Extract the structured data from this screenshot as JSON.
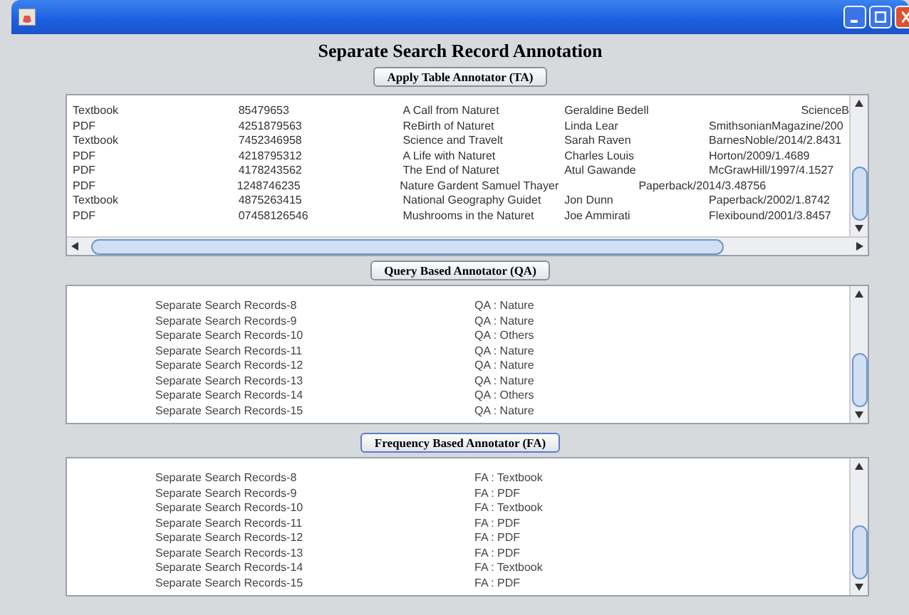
{
  "window": {
    "title": "Separate Search Record Annotation"
  },
  "table_section": {
    "button": "Apply Table Annotator (TA)",
    "rows": [
      {
        "kind": "right",
        "cells": [
          "Textbook",
          "85479653",
          "A Call from Naturet",
          "Geraldine Bedell",
          "ScienceB"
        ]
      },
      {
        "kind": "normal",
        "cells": [
          "PDF",
          "4251879563",
          "ReBirth of Naturet",
          "Linda Lear",
          "SmithsonianMagazine/200"
        ]
      },
      {
        "kind": "normal",
        "cells": [
          "Textbook",
          "7452346958",
          "Science and Travelt",
          "Sarah Raven",
          "BarnesNoble/2014/2.8431"
        ]
      },
      {
        "kind": "normal",
        "cells": [
          "PDF",
          "4218795312",
          "A Life with Naturet",
          "Charles Louis",
          "Horton/2009/1.4689"
        ]
      },
      {
        "kind": "normal",
        "cells": [
          "PDF",
          "4178243562",
          "The End of Naturet",
          "Atul Gawande",
          "McGrawHill/1997/4.1527"
        ]
      },
      {
        "kind": "shifted",
        "cells": [
          "PDF",
          "1248746235",
          "Nature Gardent Samuel Thayer",
          "Paperback/2014/3.48756"
        ]
      },
      {
        "kind": "normal",
        "cells": [
          "Textbook",
          "4875263415",
          "National Geography Guidet",
          "Jon Dunn",
          "Paperback/2002/1.8742"
        ]
      },
      {
        "kind": "normal",
        "cells": [
          "PDF",
          "07458126546",
          "Mushrooms in the Naturet",
          "Joe Ammirati",
          "Flexibound/2001/3.8457"
        ]
      }
    ]
  },
  "qa_section": {
    "button": "Query Based Annotator (QA)",
    "rows": [
      {
        "record": "Separate Search Records-8",
        "label": "QA : Nature"
      },
      {
        "record": "Separate Search Records-9",
        "label": "QA : Nature"
      },
      {
        "record": "Separate Search Records-10",
        "label": "QA : Others"
      },
      {
        "record": "Separate Search Records-11",
        "label": "QA : Nature"
      },
      {
        "record": "Separate Search Records-12",
        "label": "QA : Nature"
      },
      {
        "record": "Separate Search Records-13",
        "label": "QA : Nature"
      },
      {
        "record": "Separate Search Records-14",
        "label": "QA : Others"
      },
      {
        "record": "Separate Search Records-15",
        "label": "QA : Nature"
      }
    ]
  },
  "fa_section": {
    "button": "Frequency Based Annotator (FA)",
    "rows": [
      {
        "record": "Separate Search Records-8",
        "label": "FA : Textbook"
      },
      {
        "record": "Separate Search Records-9",
        "label": "FA : PDF"
      },
      {
        "record": "Separate Search Records-10",
        "label": "FA : Textbook"
      },
      {
        "record": "Separate Search Records-11",
        "label": "FA : PDF"
      },
      {
        "record": "Separate Search Records-12",
        "label": "FA : PDF"
      },
      {
        "record": "Separate Search Records-13",
        "label": "FA : PDF"
      },
      {
        "record": "Separate Search Records-14",
        "label": "FA : Textbook"
      },
      {
        "record": "Separate Search Records-15",
        "label": "FA : PDF"
      }
    ]
  }
}
